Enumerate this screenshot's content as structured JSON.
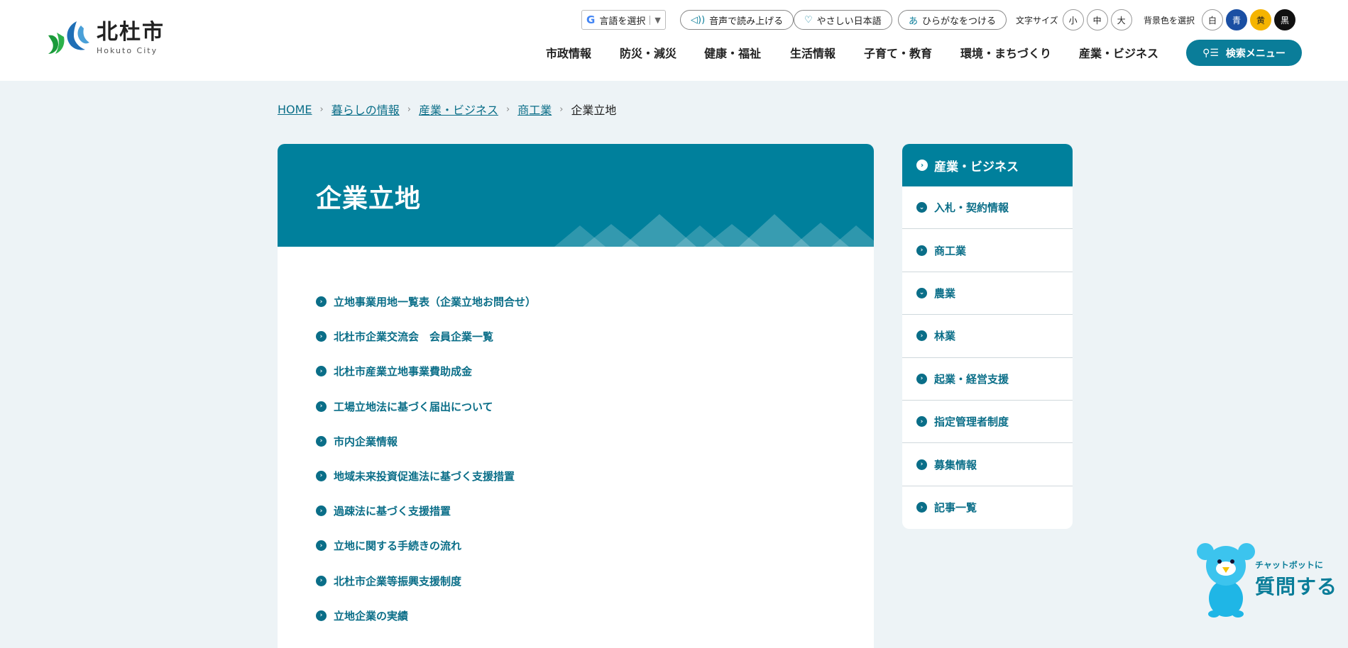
{
  "header": {
    "logo": {
      "jp": "北杜市",
      "en": "Hokuto City"
    },
    "language": {
      "g": "G",
      "label": "言語を選択",
      "caret": "▼"
    },
    "read_aloud": "音声で読み上げる",
    "easy_japanese": "やさしい日本語",
    "furigana": {
      "glyph": "あ",
      "label": "ひらがなをつける"
    },
    "font_size": {
      "label": "文字サイズ",
      "options": [
        "小",
        "中",
        "大"
      ]
    },
    "bg_color": {
      "label": "背景色を選択",
      "options": [
        "白",
        "青",
        "黄",
        "黒"
      ]
    },
    "nav": [
      "市政情報",
      "防災・減災",
      "健康・福祉",
      "生活情報",
      "子育て・教育",
      "環境・まちづくり",
      "産業・ビジネス"
    ],
    "search_menu": "検索メニュー"
  },
  "breadcrumb": {
    "items": [
      "HOME",
      "暮らしの情報",
      "産業・ビジネス",
      "商工業"
    ],
    "current": "企業立地"
  },
  "page": {
    "title": "企業立地",
    "links": [
      "立地事業用地一覧表（企業立地お問合せ）",
      "北杜市企業交流会　会員企業一覧",
      "北杜市産業立地事業費助成金",
      "工場立地法に基づく届出について",
      "市内企業情報",
      "地域未来投資促進法に基づく支援措置",
      "過疎法に基づく支援措置",
      "立地に関する手続きの流れ",
      "北杜市企業等振興支援制度",
      "立地企業の実績"
    ]
  },
  "sidebar": {
    "title": "産業・ビジネス",
    "items": [
      "入札・契約情報",
      "商工業",
      "農業",
      "林業",
      "起業・経営支援",
      "指定管理者制度",
      "募集情報",
      "記事一覧"
    ]
  },
  "chatbot": {
    "small": "チャットボットに",
    "big": "質問する"
  },
  "colors": {
    "accent": "#00809c",
    "link": "#0a6e88",
    "background": "#edf3f6"
  }
}
